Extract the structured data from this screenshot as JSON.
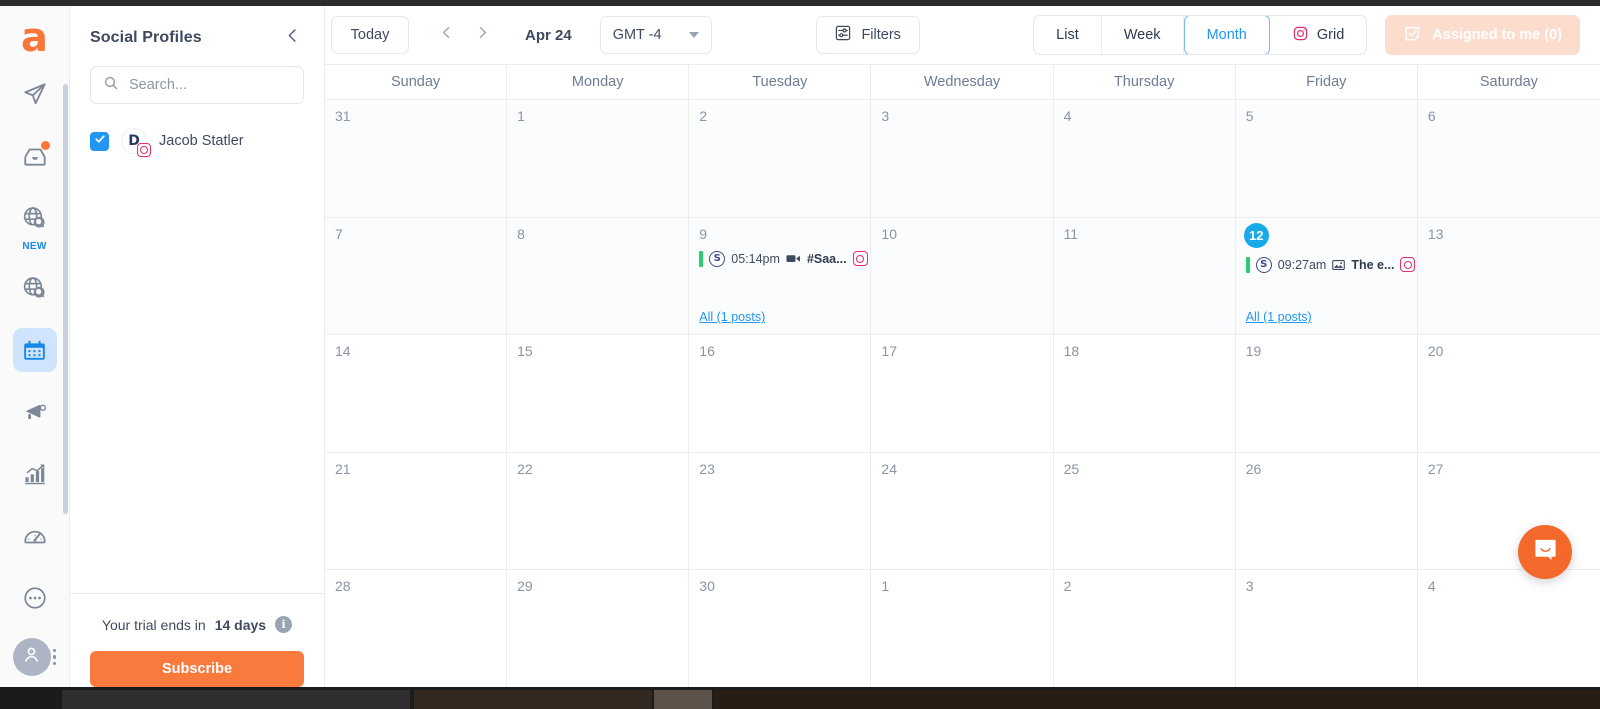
{
  "rail": {
    "logo": "a",
    "items": [
      {
        "icon": "paper-plane-icon",
        "label": "Publish",
        "badge": ""
      },
      {
        "icon": "inbox-icon",
        "label": "Inbox",
        "badge": "dot"
      },
      {
        "icon": "globe-search-icon",
        "label": "Monitor",
        "badge": "NEW"
      },
      {
        "icon": "globe-search-alt-icon",
        "label": "Listen",
        "badge": ""
      },
      {
        "icon": "calendar-icon",
        "label": "Calendar",
        "badge": "",
        "active": true
      },
      {
        "icon": "megaphone-icon",
        "label": "Campaigns",
        "badge": ""
      },
      {
        "icon": "bar-chart-icon",
        "label": "Reports",
        "badge": ""
      },
      {
        "icon": "gauge-icon",
        "label": "Dashboard",
        "badge": ""
      },
      {
        "icon": "more-circle-icon",
        "label": "More",
        "badge": ""
      }
    ],
    "new_label": "NEW"
  },
  "panel": {
    "title": "Social Profiles",
    "collapse_icon": "chevron-left-icon",
    "search": {
      "placeholder": "Search...",
      "value": "",
      "icon": "search-icon"
    },
    "profiles": [
      {
        "name": "Jacob Statler",
        "checked": true,
        "network": "instagram",
        "initial": "D"
      }
    ],
    "footer": {
      "trial_prefix": "Your trial ends in",
      "trial_days": "14 days",
      "info_icon": "info-icon",
      "subscribe_label": "Subscribe"
    }
  },
  "toolbar": {
    "today_label": "Today",
    "prev_icon": "chevron-left-icon",
    "next_icon": "chevron-right-icon",
    "period_label": "Apr 24",
    "timezone_label": "GMT -4",
    "timezone_caret": "chevron-down-icon",
    "filters_label": "Filters",
    "filters_icon": "sliders-icon",
    "views": [
      {
        "label": "List",
        "active": false,
        "icon": ""
      },
      {
        "label": "Week",
        "active": false,
        "icon": ""
      },
      {
        "label": "Month",
        "active": true,
        "icon": ""
      },
      {
        "label": "Grid",
        "active": false,
        "icon": "instagram-icon"
      }
    ],
    "assigned_label": "Assigned to me (0)",
    "assigned_icon": "checkbox-note-icon"
  },
  "calendar": {
    "weekdays": [
      "Sunday",
      "Monday",
      "Tuesday",
      "Wednesday",
      "Thursday",
      "Friday",
      "Saturday"
    ],
    "weeks": [
      {
        "shade": true,
        "days": [
          {
            "num": "31"
          },
          {
            "num": "1"
          },
          {
            "num": "2"
          },
          {
            "num": "3"
          },
          {
            "num": "4"
          },
          {
            "num": "5"
          },
          {
            "num": "6"
          }
        ]
      },
      {
        "shade": true,
        "days": [
          {
            "num": "7"
          },
          {
            "num": "8"
          },
          {
            "num": "9",
            "events": [
              {
                "time": "05:14pm",
                "title": "#Saa...",
                "media_icon": "video-icon",
                "network": "instagram",
                "source": "S",
                "bar_color": "#2ecc71"
              }
            ],
            "all_link": "All (1 posts)"
          },
          {
            "num": "10"
          },
          {
            "num": "11"
          },
          {
            "num": "12",
            "today": true,
            "events": [
              {
                "time": "09:27am",
                "title": "The e...",
                "media_icon": "image-icon",
                "network": "instagram",
                "source": "S",
                "bar_color": "#2ecc71"
              }
            ],
            "all_link": "All (1 posts)"
          },
          {
            "num": "13"
          }
        ]
      },
      {
        "shade": false,
        "days": [
          {
            "num": "14"
          },
          {
            "num": "15"
          },
          {
            "num": "16"
          },
          {
            "num": "17"
          },
          {
            "num": "18"
          },
          {
            "num": "19"
          },
          {
            "num": "20"
          }
        ]
      },
      {
        "shade": false,
        "days": [
          {
            "num": "21"
          },
          {
            "num": "22"
          },
          {
            "num": "23"
          },
          {
            "num": "24"
          },
          {
            "num": "25"
          },
          {
            "num": "26"
          },
          {
            "num": "27"
          }
        ]
      },
      {
        "shade": false,
        "days": [
          {
            "num": "28"
          },
          {
            "num": "29"
          },
          {
            "num": "30"
          },
          {
            "num": "1"
          },
          {
            "num": "2"
          },
          {
            "num": "3"
          },
          {
            "num": "4"
          }
        ]
      }
    ]
  },
  "chat": {
    "icon": "chat-bubble-icon"
  },
  "colors": {
    "brand_orange": "#f97639",
    "accent_blue": "#2196f3",
    "today_badge": "#17a9e8",
    "event_bar_green": "#2ecc71",
    "instagram": "#e1306c"
  }
}
